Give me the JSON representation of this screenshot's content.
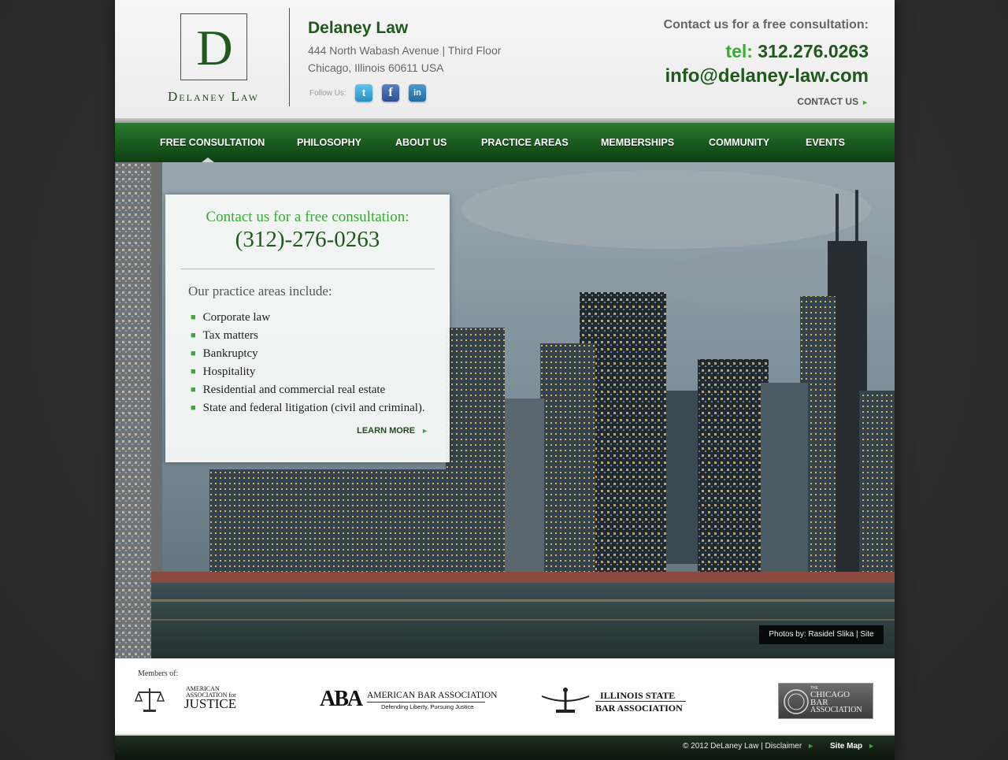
{
  "header": {
    "logo_letter": "D",
    "logo_name": "Delaney Law",
    "firm_name": "Delaney Law",
    "address_line1": "444 North Wabash Avenue | Third Floor",
    "address_line2": "Chicago, Illinois 60611 USA",
    "follow_label": "Follow Us:",
    "social": [
      {
        "name": "twitter-icon",
        "glyph": "t"
      },
      {
        "name": "facebook-icon",
        "glyph": "f"
      },
      {
        "name": "linkedin-icon",
        "glyph": "in"
      }
    ],
    "cta": "Contact us for a free consultation:",
    "tel_label": "tel:",
    "tel_number": "312.276.0263",
    "email": "info@delaney-law.com",
    "contact_link": "CONTACT US"
  },
  "nav": {
    "items": [
      "FREE CONSULTATION",
      "PHILOSOPHY",
      "ABOUT US",
      "PRACTICE AREAS",
      "MEMBERSHIPS",
      "COMMUNITY",
      "EVENTS"
    ],
    "active_index": 0
  },
  "hero": {
    "panel": {
      "cta": "Contact us for a free consultation:",
      "phone": "(312)-276-0263",
      "heading": "Our practice areas include:",
      "practice_areas": [
        "Corporate law",
        "Tax matters",
        "Bankruptcy",
        "Hospitality",
        "Residential and commercial real estate",
        "State and federal litigation (civil and criminal)."
      ],
      "learn_more": "LEARN MORE"
    },
    "credit": "Photos by: Rasidel Slika  |  Site"
  },
  "members": {
    "label": "Members of:",
    "aaj_line1": "AMERICAN",
    "aaj_line2": "ASSOCIATION for",
    "aaj_line3": "JUSTICE",
    "aba_mark": "ABA",
    "aba_name": "AMERICAN BAR ASSOCIATION",
    "aba_tagline": "Defending Liberty, Pursuing Justice",
    "isba_line1": "ILLINOIS STATE",
    "isba_line2": "BAR ASSOCIATION",
    "cba_line0": "THE",
    "cba_line1": "CHICAGO",
    "cba_line2": "BAR",
    "cba_line3": "ASSOCIATION"
  },
  "footer": {
    "copyright": "© 2012 DeLaney Law  |  Disclaimer",
    "sitemap": "Site Map"
  },
  "colors": {
    "brand_green": "#1f5a1c",
    "accent_green": "#3aaa35",
    "nav_green": "#1b5e20"
  }
}
